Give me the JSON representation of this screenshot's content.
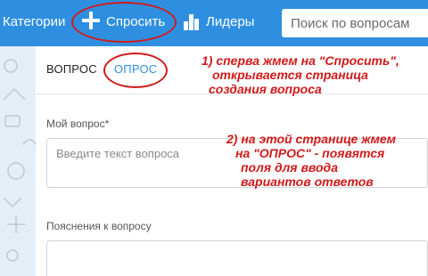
{
  "nav": {
    "categories": "Категории",
    "ask": "Спросить",
    "leaders": "Лидеры"
  },
  "search": {
    "placeholder": "Поиск по вопросам"
  },
  "tabs": {
    "question": "ВОПРОС",
    "poll": "ОПРОС"
  },
  "form": {
    "question_label": "Мой вопрос*",
    "question_placeholder": "Введите текст вопроса",
    "explanation_label": "Пояснения к вопросу"
  },
  "annotations": {
    "note1": [
      "1) сперва жмем на \"Спросить\",",
      "открывается страница",
      "создания вопроса"
    ],
    "note2": [
      "2) на этой странице жмем",
      "на \"ОПРОС\" - появятся",
      "поля для ввода",
      "вариантов ответов"
    ]
  },
  "colors": {
    "brand": "#2e8fe0",
    "annotation": "#d11a1a"
  }
}
